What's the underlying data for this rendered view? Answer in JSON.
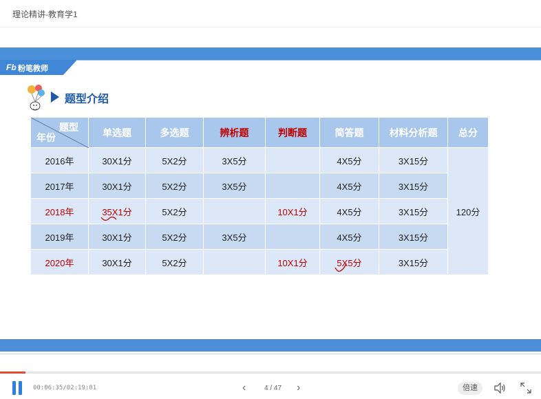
{
  "window": {
    "title": "理论精讲-教育学1"
  },
  "slide": {
    "logo_mark": "Fb",
    "logo_text": "粉笔教师",
    "heading": "题型介绍",
    "table": {
      "corner_top": "题型",
      "corner_bottom": "年份",
      "headers": [
        {
          "label": "单选题",
          "red": false
        },
        {
          "label": "多选题",
          "red": false
        },
        {
          "label": "辨析题",
          "red": true
        },
        {
          "label": "判断题",
          "red": true
        },
        {
          "label": "简答题",
          "red": false
        },
        {
          "label": "材料分析题",
          "red": false
        },
        {
          "label": "总分",
          "red": false
        }
      ],
      "rows": [
        {
          "year": "2016年",
          "red": false,
          "cells": [
            "30X1分",
            "5X2分",
            "3X5分",
            "",
            "4X5分",
            "3X15分"
          ]
        },
        {
          "year": "2017年",
          "red": false,
          "cells": [
            "30X1分",
            "5X2分",
            "3X5分",
            "",
            "4X5分",
            "3X15分"
          ]
        },
        {
          "year": "2018年",
          "red": true,
          "cells": [
            "35X1分",
            "5X2分",
            "",
            "10X1分",
            "4X5分",
            "3X15分"
          ]
        },
        {
          "year": "2019年",
          "red": false,
          "cells": [
            "30X1分",
            "5X2分",
            "3X5分",
            "",
            "4X5分",
            "3X15分"
          ]
        },
        {
          "year": "2020年",
          "red": true,
          "cells": [
            "30X1分",
            "5X2分",
            "",
            "10X1分",
            "5X5分",
            "3X15分"
          ]
        }
      ],
      "total": "120分"
    }
  },
  "player": {
    "time": "00:06:35/02:19:01",
    "progress": 0.047,
    "page_counter": "4 / 47",
    "speed_label": "倍速"
  },
  "colors": {
    "accent": "#4b8fd8",
    "header": "#a9c6ec",
    "highlight": "#c00000",
    "pause": "#2d7fe0"
  }
}
